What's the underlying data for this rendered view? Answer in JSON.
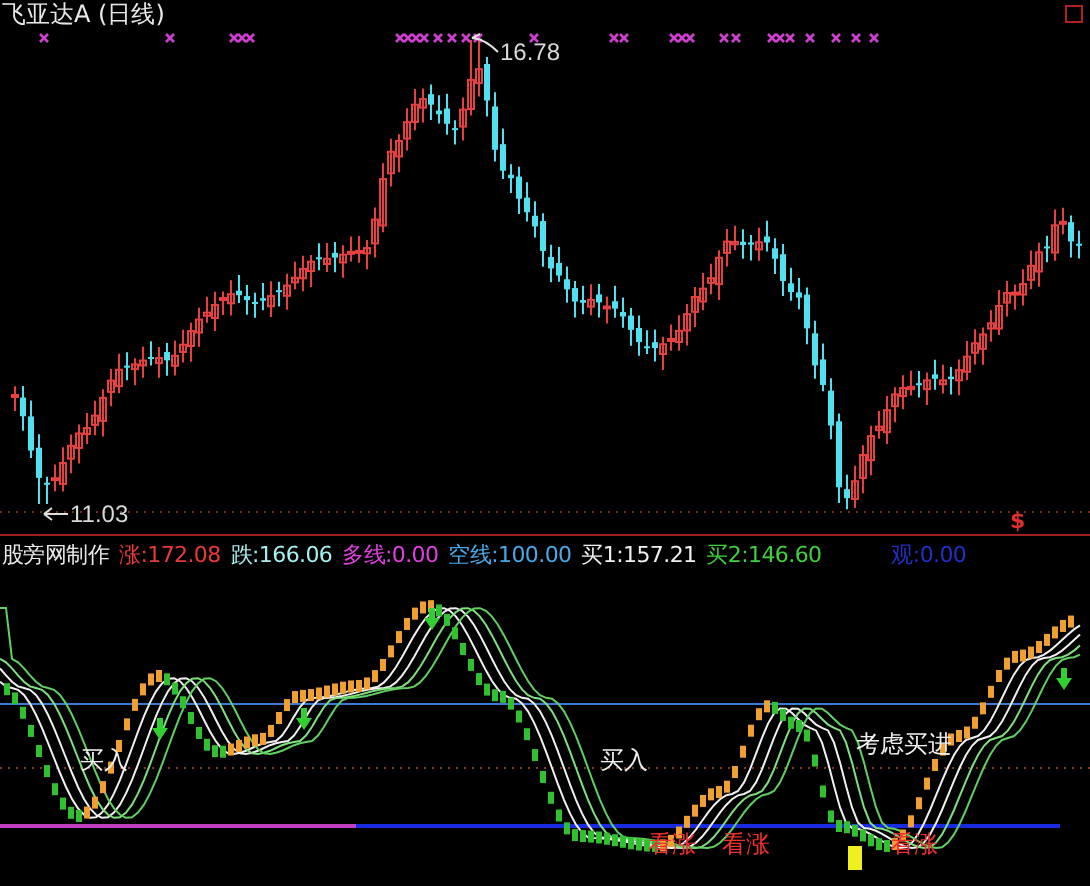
{
  "title": "飞亚达A (日线)",
  "price_chart": {
    "high_label": "16.78",
    "low_label": "11.03",
    "signal_mark": "$"
  },
  "indicator": {
    "name": "股旁网制作",
    "values": [
      {
        "text": "涨:172.08",
        "color": "#e83a3a"
      },
      {
        "text": "跌:166.06",
        "color": "#a8f0f0"
      },
      {
        "text": "多线:0.00",
        "color": "#e040e0"
      },
      {
        "text": "空线:100.00",
        "color": "#4aa8e8"
      },
      {
        "text": "买1:157.21",
        "color": "#f0f0f0"
      },
      {
        "text": "买2:146.60",
        "color": "#40d040"
      },
      {
        "text": "观:0.00",
        "color": "#2030c8"
      }
    ]
  },
  "annotations": [
    {
      "kind": "buy",
      "text": "买入"
    },
    {
      "kind": "buy",
      "text": "买入"
    },
    {
      "kind": "buy",
      "text": "考虑买进"
    },
    {
      "kind": "bullish",
      "text": "看涨"
    },
    {
      "kind": "bullish",
      "text": "看涨"
    },
    {
      "kind": "bullish",
      "text": "看涨"
    }
  ]
}
